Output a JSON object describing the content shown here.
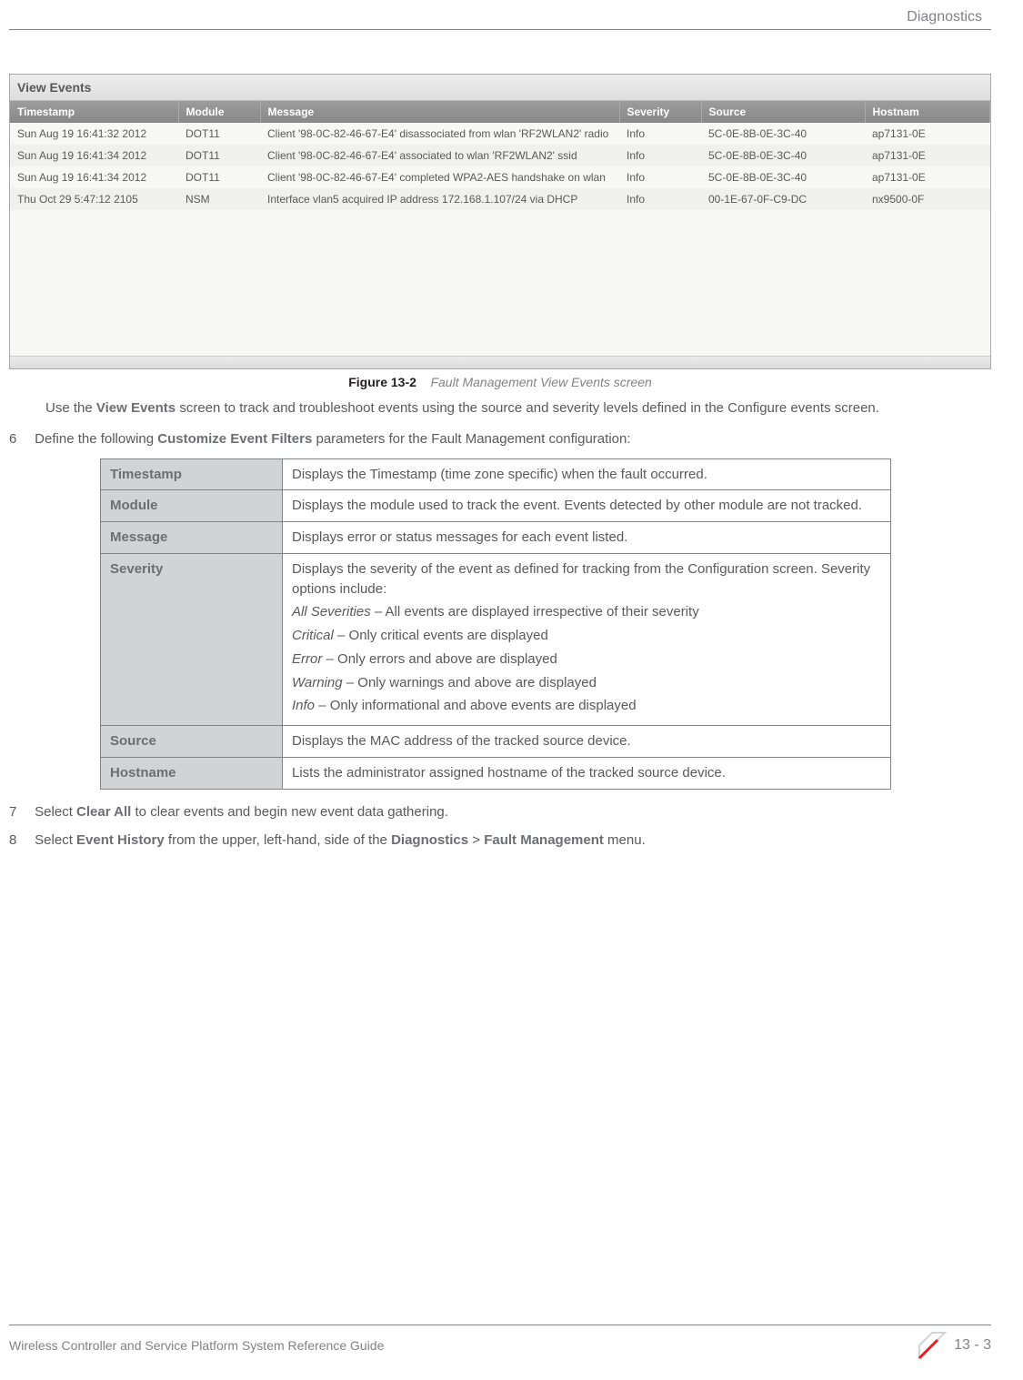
{
  "header": {
    "title": "Diagnostics"
  },
  "screenshot": {
    "title": "View Events",
    "columns": [
      "Timestamp",
      "Module",
      "Message",
      "Severity",
      "Source",
      "Hostnam"
    ],
    "rows": [
      {
        "ts": "Sun Aug 19 16:41:32 2012",
        "mod": "DOT11",
        "msg": "Client '98-0C-82-46-67-E4' disassociated from wlan 'RF2WLAN2' radio",
        "sev": "Info",
        "src": "5C-0E-8B-0E-3C-40",
        "host": "ap7131-0E"
      },
      {
        "ts": "Sun Aug 19 16:41:34 2012",
        "mod": "DOT11",
        "msg": "Client '98-0C-82-46-67-E4' associated to wlan 'RF2WLAN2' ssid",
        "sev": "Info",
        "src": "5C-0E-8B-0E-3C-40",
        "host": "ap7131-0E"
      },
      {
        "ts": "Sun Aug 19 16:41:34 2012",
        "mod": "DOT11",
        "msg": "Client '98-0C-82-46-67-E4' completed WPA2-AES handshake on wlan",
        "sev": "Info",
        "src": "5C-0E-8B-0E-3C-40",
        "host": "ap7131-0E"
      },
      {
        "ts": "Thu Oct 29 5:47:12 2105",
        "mod": "NSM",
        "msg": "Interface vlan5 acquired IP address 172.168.1.107/24 via DHCP",
        "sev": "Info",
        "src": "00-1E-67-0F-C9-DC",
        "host": "nx9500-0F"
      }
    ]
  },
  "figure": {
    "label": "Figure 13-2",
    "title": "Fault Management View Events screen"
  },
  "intro": {
    "pre": "Use the ",
    "bold": "View Events",
    "post": " screen to track and troubleshoot events using the source and severity levels defined in the Configure events screen."
  },
  "step6": {
    "num": "6",
    "pre": "Define the following ",
    "bold": "Customize Event Filters",
    "post": " parameters for the Fault Management configuration:"
  },
  "params": {
    "timestamp": {
      "label": "Timestamp",
      "desc": "Displays the Timestamp (time zone specific) when the fault occurred."
    },
    "module": {
      "label": "Module",
      "desc": "Displays the module used to track the event. Events detected by other module are not tracked."
    },
    "message": {
      "label": "Message",
      "desc": "Displays error or status messages for each event listed."
    },
    "severity": {
      "label": "Severity",
      "desc": "Displays the severity of the event as defined for tracking from the Configuration screen. Severity options include:",
      "opts": [
        {
          "name": "All Severities",
          "desc": " – All events are displayed irrespective of their severity"
        },
        {
          "name": "Critical",
          "desc": " – Only critical events are displayed"
        },
        {
          "name": "Error",
          "desc": " – Only errors and above are displayed"
        },
        {
          "name": "Warning",
          "desc": " – Only warnings and above are displayed"
        },
        {
          "name": "Info",
          "desc": " – Only informational and above events are displayed"
        }
      ]
    },
    "source": {
      "label": "Source",
      "desc": "Displays the MAC address of the tracked source device."
    },
    "hostname": {
      "label": "Hostname",
      "desc": "Lists the administrator assigned hostname of the tracked source device."
    }
  },
  "step7": {
    "num": "7",
    "pre": "Select ",
    "bold": "Clear All",
    "post": " to clear events and begin new event data gathering."
  },
  "step8": {
    "num": "8",
    "pre": "Select ",
    "bold1": "Event History",
    "mid": " from the upper, left-hand, side of the ",
    "bold2": "Diagnostics",
    "gt": " > ",
    "bold3": "Fault Management",
    "post": " menu."
  },
  "footer": {
    "guide": "Wireless Controller and Service Platform System Reference Guide",
    "page": "13 - 3"
  }
}
